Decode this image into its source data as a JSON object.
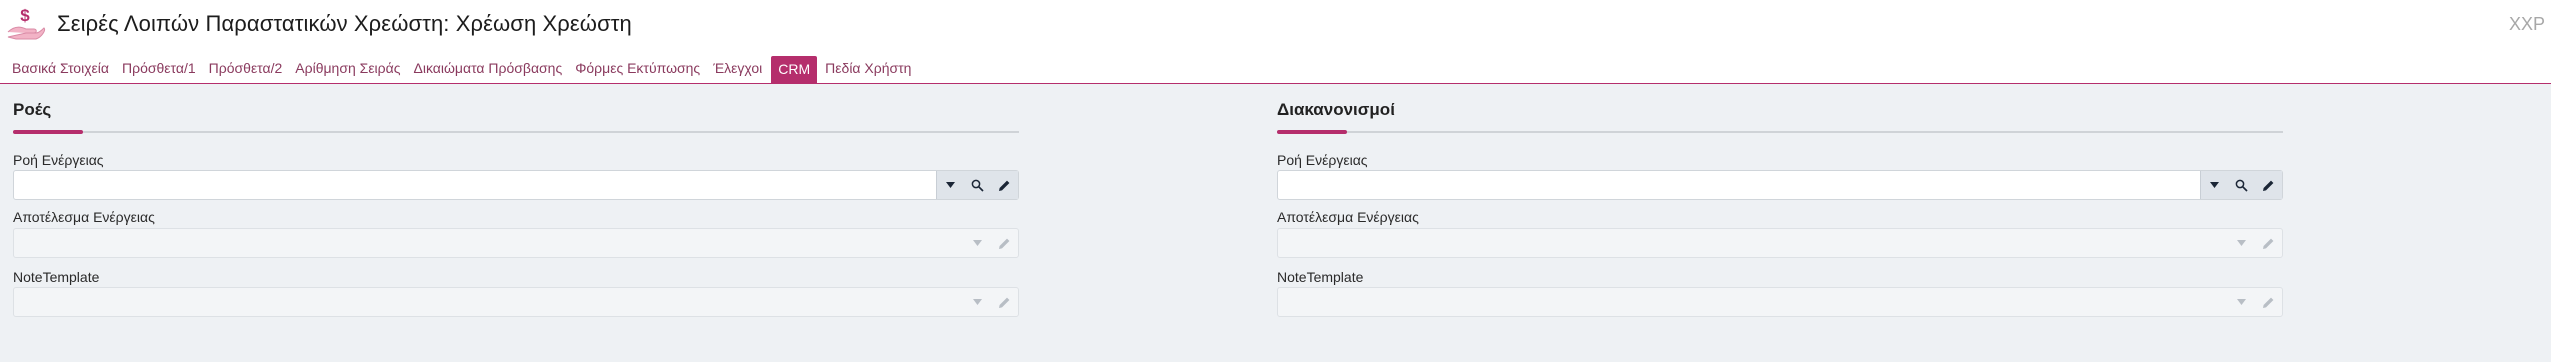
{
  "header": {
    "title": "Σειρές Λοιπών Παραστατικών Χρεώστη: Χρέωση Χρεώστη",
    "code": "XXP",
    "icon": "hand-money-icon"
  },
  "tabs": [
    {
      "label": "Βασικά Στοιχεία",
      "active": false
    },
    {
      "label": "Πρόσθετα/1",
      "active": false
    },
    {
      "label": "Πρόσθετα/2",
      "active": false
    },
    {
      "label": "Αρίθμηση Σειράς",
      "active": false
    },
    {
      "label": "Δικαιώματα Πρόσβασης",
      "active": false
    },
    {
      "label": "Φόρμες Εκτύπωσης",
      "active": false
    },
    {
      "label": "Έλεγχοι",
      "active": false
    },
    {
      "label": "CRM",
      "active": true
    },
    {
      "label": "Πεδία Χρήστη",
      "active": false
    }
  ],
  "sections": {
    "left": {
      "title": "Ροές",
      "fields": [
        {
          "label": "Ροή Ενέργειας",
          "value": "",
          "enabled": true
        },
        {
          "label": "Αποτέλεσμα Ενέργειας",
          "value": "",
          "enabled": false
        },
        {
          "label": "NoteTemplate",
          "value": "",
          "enabled": false
        }
      ]
    },
    "right": {
      "title": "Διακανονισμοί",
      "fields": [
        {
          "label": "Ροή Ενέργειας",
          "value": "",
          "enabled": true
        },
        {
          "label": "Αποτέλεσμα Ενέργειας",
          "value": "",
          "enabled": false
        },
        {
          "label": "NoteTemplate",
          "value": "",
          "enabled": false
        }
      ]
    }
  },
  "colors": {
    "accent": "#b52e6c",
    "tab_text": "#8a3a5e",
    "content_bg": "#eef1f4"
  }
}
